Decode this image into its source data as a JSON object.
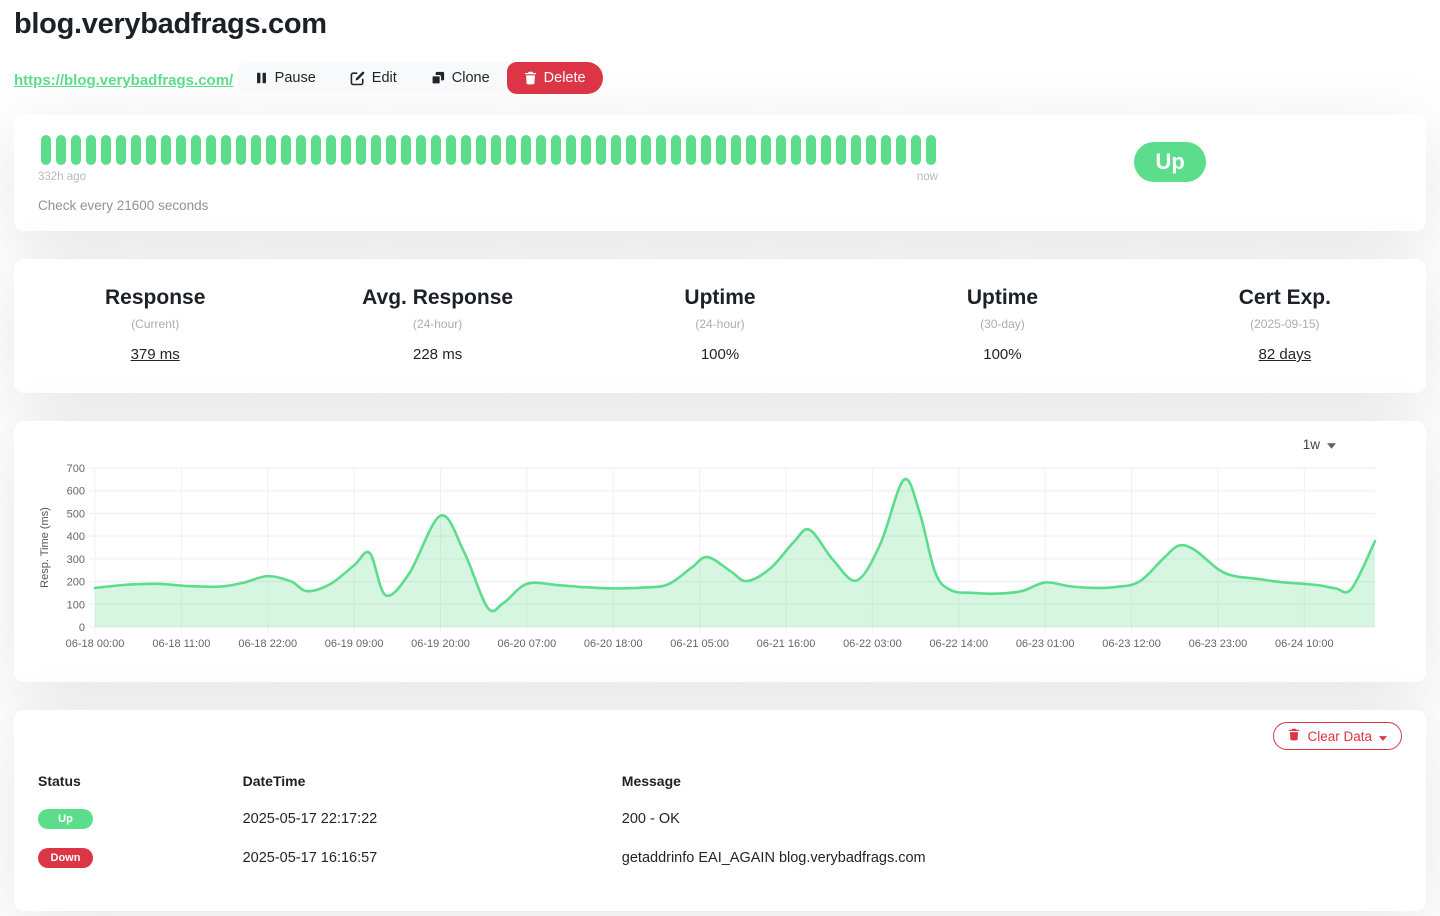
{
  "header": {
    "title": "blog.verybadfrags.com",
    "url": "https://blog.verybadfrags.com/"
  },
  "toolbar": {
    "pause_label": "Pause",
    "edit_label": "Edit",
    "clone_label": "Clone",
    "delete_label": "Delete"
  },
  "monitor": {
    "status": "Up",
    "check_interval": "Check every 21600 seconds",
    "heartbeat": {
      "count": 60,
      "start_label": "332h ago",
      "end_label": "now",
      "beat_color": "#5cdd8b"
    }
  },
  "stats": [
    {
      "title": "Response",
      "subtitle": "(Current)",
      "value": "379 ms"
    },
    {
      "title": "Avg. Response",
      "subtitle": "(24-hour)",
      "value": "228 ms"
    },
    {
      "title": "Uptime",
      "subtitle": "(24-hour)",
      "value": "100%"
    },
    {
      "title": "Uptime",
      "subtitle": "(30-day)",
      "value": "100%"
    },
    {
      "title": "Cert Exp.",
      "subtitle": "(2025-09-15)",
      "value": "82 days"
    }
  ],
  "chart_controls": {
    "period": "1w"
  },
  "chart_data": {
    "type": "area",
    "title": "",
    "xlabel": "",
    "ylabel": "Resp. Time (ms)",
    "ylim": [
      0,
      700
    ],
    "yticks": [
      0,
      100,
      200,
      300,
      400,
      500,
      600,
      700
    ],
    "x_hours_range": [
      0,
      163
    ],
    "xticks": [
      {
        "h": 0,
        "label": "06-18 00:00"
      },
      {
        "h": 11,
        "label": "06-18 11:00"
      },
      {
        "h": 22,
        "label": "06-18 22:00"
      },
      {
        "h": 33,
        "label": "06-19 09:00"
      },
      {
        "h": 44,
        "label": "06-19 20:00"
      },
      {
        "h": 55,
        "label": "06-20 07:00"
      },
      {
        "h": 66,
        "label": "06-20 18:00"
      },
      {
        "h": 77,
        "label": "06-21 05:00"
      },
      {
        "h": 88,
        "label": "06-21 16:00"
      },
      {
        "h": 99,
        "label": "06-22 03:00"
      },
      {
        "h": 110,
        "label": "06-22 14:00"
      },
      {
        "h": 121,
        "label": "06-23 01:00"
      },
      {
        "h": 132,
        "label": "06-23 12:00"
      },
      {
        "h": 143,
        "label": "06-23 23:00"
      },
      {
        "h": 154,
        "label": "06-24 10:00"
      }
    ],
    "grid": true,
    "legend": "none",
    "line_color": "#5cdd8b",
    "fill_color": "rgba(92,221,139,0.25)",
    "series": [
      {
        "name": "Resp. Time (ms)",
        "points_hours_ms": [
          [
            0,
            172
          ],
          [
            4,
            186
          ],
          [
            8,
            190
          ],
          [
            12,
            180
          ],
          [
            16,
            178
          ],
          [
            19,
            196
          ],
          [
            22,
            224
          ],
          [
            25,
            200
          ],
          [
            27,
            158
          ],
          [
            30,
            190
          ],
          [
            33,
            272
          ],
          [
            35,
            325
          ],
          [
            37,
            140
          ],
          [
            40,
            235
          ],
          [
            44,
            490
          ],
          [
            47,
            330
          ],
          [
            50,
            85
          ],
          [
            52,
            105
          ],
          [
            55,
            190
          ],
          [
            59,
            184
          ],
          [
            62,
            176
          ],
          [
            66,
            170
          ],
          [
            70,
            174
          ],
          [
            73,
            188
          ],
          [
            76,
            262
          ],
          [
            78,
            308
          ],
          [
            81,
            244
          ],
          [
            83,
            202
          ],
          [
            86,
            258
          ],
          [
            89,
            375
          ],
          [
            91,
            428
          ],
          [
            94,
            295
          ],
          [
            97,
            205
          ],
          [
            100,
            365
          ],
          [
            103,
            648
          ],
          [
            105,
            505
          ],
          [
            107,
            240
          ],
          [
            109,
            162
          ],
          [
            112,
            150
          ],
          [
            115,
            147
          ],
          [
            118,
            158
          ],
          [
            121,
            196
          ],
          [
            124,
            180
          ],
          [
            127,
            172
          ],
          [
            130,
            176
          ],
          [
            133,
            200
          ],
          [
            136,
            300
          ],
          [
            138,
            358
          ],
          [
            140,
            340
          ],
          [
            143,
            255
          ],
          [
            145,
            225
          ],
          [
            148,
            212
          ],
          [
            151,
            198
          ],
          [
            154,
            190
          ],
          [
            156,
            183
          ],
          [
            158,
            170
          ],
          [
            160,
            168
          ],
          [
            163,
            378
          ]
        ]
      }
    ]
  },
  "events": {
    "clear_button_label": "Clear Data",
    "columns": {
      "status": "Status",
      "datetime": "DateTime",
      "message": "Message"
    },
    "rows": [
      {
        "status": "Up",
        "datetime": "2025-05-17 22:17:22",
        "message": "200 - OK"
      },
      {
        "status": "Down",
        "datetime": "2025-05-17 16:16:57",
        "message": "getaddrinfo EAI_AGAIN blog.verybadfrags.com"
      }
    ]
  },
  "colors": {
    "accent_green": "#5cdd8b",
    "danger_red": "#dc3545",
    "grid_line": "#ededed",
    "muted_text": "#a8aeb3"
  }
}
